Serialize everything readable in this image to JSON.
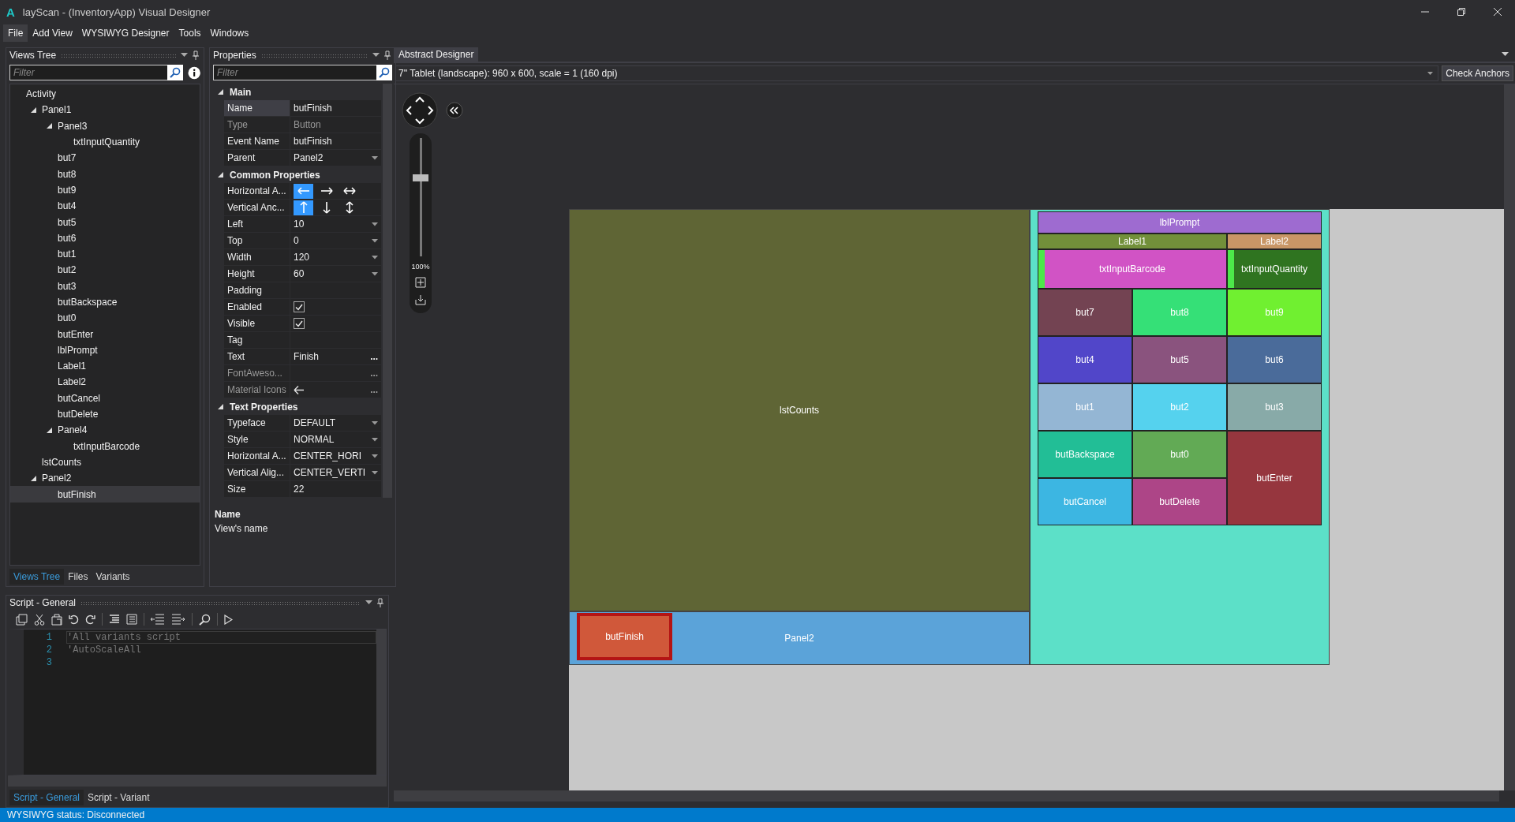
{
  "window": {
    "logo": "A",
    "title": "layScan - (InventoryApp) Visual Designer"
  },
  "menu": [
    {
      "label": "File",
      "selected": true
    },
    {
      "label": "Add View",
      "selected": false
    },
    {
      "label": "WYSIWYG Designer",
      "selected": false
    },
    {
      "label": "Tools",
      "selected": false
    },
    {
      "label": "Windows",
      "selected": false
    }
  ],
  "views_tree": {
    "title": "Views Tree",
    "filter_placeholder": "Filter",
    "items": [
      {
        "label": "Activity",
        "selected": false,
        "children": [
          {
            "label": "Panel1",
            "selected": false,
            "expanded": true,
            "children": [
              {
                "label": "Panel3",
                "selected": false,
                "expanded": true,
                "children": [
                  {
                    "label": "txtInputQuantity",
                    "selected": false
                  }
                ]
              },
              {
                "label": "but7",
                "selected": false
              },
              {
                "label": "but8",
                "selected": false
              },
              {
                "label": "but9",
                "selected": false
              },
              {
                "label": "but4",
                "selected": false
              },
              {
                "label": "but5",
                "selected": false
              },
              {
                "label": "but6",
                "selected": false
              },
              {
                "label": "but1",
                "selected": false
              },
              {
                "label": "but2",
                "selected": false
              },
              {
                "label": "but3",
                "selected": false
              },
              {
                "label": "butBackspace",
                "selected": false
              },
              {
                "label": "but0",
                "selected": false
              },
              {
                "label": "butEnter",
                "selected": false
              },
              {
                "label": "lblPrompt",
                "selected": false
              },
              {
                "label": "Label1",
                "selected": false
              },
              {
                "label": "Label2",
                "selected": false
              },
              {
                "label": "butCancel",
                "selected": false
              },
              {
                "label": "butDelete",
                "selected": false
              },
              {
                "label": "Panel4",
                "selected": false,
                "expanded": true,
                "children": [
                  {
                    "label": "txtInputBarcode",
                    "selected": false
                  }
                ]
              }
            ]
          },
          {
            "label": "lstCounts",
            "selected": false
          },
          {
            "label": "Panel2",
            "selected": false,
            "expanded": true,
            "children": [
              {
                "label": "butFinish",
                "selected": true
              }
            ]
          }
        ]
      }
    ],
    "tabs": [
      {
        "label": "Views Tree",
        "selected": true
      },
      {
        "label": "Files",
        "selected": false
      },
      {
        "label": "Variants",
        "selected": false
      }
    ]
  },
  "properties": {
    "title": "Properties",
    "filter_placeholder": "Filter",
    "sections": [
      {
        "title": "Main",
        "expanded": true,
        "rows": [
          {
            "name": "Name",
            "value": "butFinish",
            "kind": "text",
            "selected": true,
            "disabled": false
          },
          {
            "name": "Type",
            "value": "Button",
            "kind": "text",
            "selected": false,
            "disabled": true
          },
          {
            "name": "Event Name",
            "value": "butFinish",
            "kind": "text",
            "selected": false,
            "disabled": false
          },
          {
            "name": "Parent",
            "value": "Panel2",
            "kind": "dropdown",
            "selected": false,
            "disabled": false
          }
        ]
      },
      {
        "title": "Common Properties",
        "expanded": true,
        "rows": [
          {
            "name": "Horizontal A...",
            "kind": "anchor_h",
            "selected": false,
            "disabled": false,
            "options": [
              {
                "selected": true
              },
              {
                "selected": false
              },
              {
                "selected": false
              }
            ]
          },
          {
            "name": "Vertical Anc...",
            "kind": "anchor_v",
            "selected": false,
            "disabled": false,
            "options": [
              {
                "selected": true
              },
              {
                "selected": false
              },
              {
                "selected": false
              }
            ]
          },
          {
            "name": "Left",
            "value": "10",
            "kind": "dropdown",
            "selected": false,
            "disabled": false
          },
          {
            "name": "Top",
            "value": "0",
            "kind": "dropdown",
            "selected": false,
            "disabled": false
          },
          {
            "name": "Width",
            "value": "120",
            "kind": "dropdown",
            "selected": false,
            "disabled": false
          },
          {
            "name": "Height",
            "value": "60",
            "kind": "dropdown",
            "selected": false,
            "disabled": false
          },
          {
            "name": "Padding",
            "kind": "text",
            "selected": false,
            "disabled": false
          },
          {
            "name": "Enabled",
            "kind": "check",
            "checked": true,
            "selected": false,
            "disabled": false
          },
          {
            "name": "Visible",
            "kind": "check",
            "checked": true,
            "selected": false,
            "disabled": false
          },
          {
            "name": "Tag",
            "kind": "text",
            "selected": false,
            "disabled": false
          },
          {
            "name": "Text",
            "value": "Finish",
            "kind": "more",
            "more": "...",
            "selected": false,
            "disabled": false
          },
          {
            "name": "FontAweso...",
            "kind": "more",
            "more": "...",
            "selected": false,
            "disabled": true
          },
          {
            "name": "Material Icons",
            "kind": "icon",
            "more": "...",
            "selected": false,
            "disabled": true
          }
        ]
      },
      {
        "title": "Text Properties",
        "expanded": true,
        "rows": [
          {
            "name": "Typeface",
            "value": "DEFAULT",
            "kind": "dropdown",
            "selected": false,
            "disabled": false
          },
          {
            "name": "Style",
            "value": "NORMAL",
            "kind": "dropdown",
            "selected": false,
            "disabled": false
          },
          {
            "name": "Horizontal A...",
            "value": "CENTER_HORI",
            "kind": "dropdown",
            "selected": false,
            "disabled": false
          },
          {
            "name": "Vertical Alig...",
            "value": "CENTER_VERTI",
            "kind": "dropdown",
            "selected": false,
            "disabled": false
          },
          {
            "name": "Size",
            "value": "22",
            "kind": "text",
            "selected": false,
            "disabled": false
          }
        ]
      }
    ],
    "help": {
      "title": "Name",
      "text": "View's name"
    }
  },
  "script": {
    "title": "Script - General",
    "lines": [
      {
        "number": "1",
        "text": "'All variants script",
        "selected": true
      },
      {
        "number": "2",
        "text": "'AutoScaleAll",
        "selected": false
      },
      {
        "number": "3",
        "selected": false
      }
    ],
    "tabs": [
      {
        "label": "Script - General",
        "selected": true
      },
      {
        "label": "Script - Variant",
        "selected": false
      }
    ]
  },
  "designer": {
    "tab": "Abstract Designer",
    "device": "7'' Tablet (landscape): 960 x 600, scale = 1 (160 dpi)",
    "check_anchors": "Check Anchors",
    "zoom": {
      "label": "100%",
      "level": 0.66
    },
    "list": {
      "label": "lstCounts",
      "color": "#5f6535"
    },
    "panel2": {
      "label": "Panel2",
      "color": "#5ba3d9",
      "button": {
        "label": "butFinish",
        "color": "#d0583a",
        "selected": true
      }
    },
    "panel1": {
      "color": "#5ce0c8",
      "views": [
        {
          "label": "lblPrompt",
          "kind": "label",
          "color": "#9e6bd0"
        },
        {
          "label": "Label1",
          "kind": "label",
          "color": "#72903a"
        },
        {
          "label": "Label2",
          "kind": "label",
          "color": "#c99666"
        },
        {
          "label": "txtInputBarcode",
          "kind": "input",
          "color": "#d153c5"
        },
        {
          "label": "txtInputQuantity",
          "kind": "input",
          "color": "#2f7420"
        },
        {
          "label": "but7",
          "kind": "button",
          "color": "#734352"
        },
        {
          "label": "but8",
          "kind": "button",
          "color": "#35e077"
        },
        {
          "label": "but9",
          "kind": "button",
          "color": "#70f030"
        },
        {
          "label": "but4",
          "kind": "button",
          "color": "#5146c9"
        },
        {
          "label": "but5",
          "kind": "button",
          "color": "#8a537e"
        },
        {
          "label": "but6",
          "kind": "button",
          "color": "#4a6b9a"
        },
        {
          "label": "but1",
          "kind": "button",
          "color": "#94b6d4"
        },
        {
          "label": "but2",
          "kind": "button",
          "color": "#55d2ee"
        },
        {
          "label": "but3",
          "kind": "button",
          "color": "#88aaa8"
        },
        {
          "label": "butBackspace",
          "kind": "button",
          "color": "#22be96"
        },
        {
          "label": "but0",
          "kind": "button",
          "color": "#62aa55"
        },
        {
          "label": "butEnter",
          "kind": "button",
          "color": "#96363e"
        },
        {
          "label": "butCancel",
          "kind": "button",
          "color": "#3cb6e2"
        },
        {
          "label": "butDelete",
          "kind": "button",
          "color": "#ad4587"
        }
      ]
    }
  },
  "status_bar": {
    "text": "WYSIWYG status: Disconnected"
  }
}
